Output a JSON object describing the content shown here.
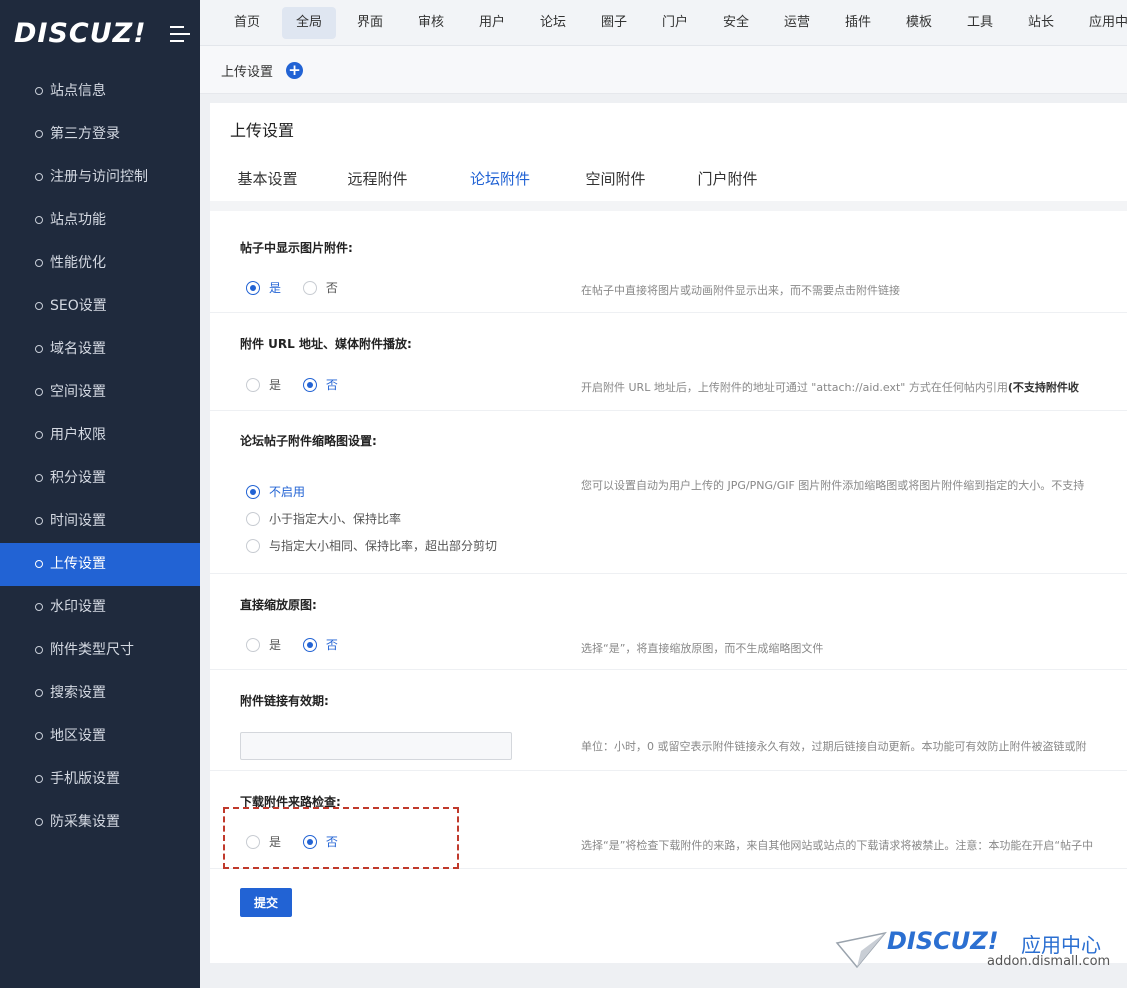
{
  "brand": {
    "logo": "DISCUZ!"
  },
  "sidebar": {
    "items": [
      {
        "label": "站点信息"
      },
      {
        "label": "第三方登录"
      },
      {
        "label": "注册与访问控制"
      },
      {
        "label": "站点功能"
      },
      {
        "label": "性能优化"
      },
      {
        "label": "SEO设置"
      },
      {
        "label": "域名设置"
      },
      {
        "label": "空间设置"
      },
      {
        "label": "用户权限"
      },
      {
        "label": "积分设置"
      },
      {
        "label": "时间设置"
      },
      {
        "label": "上传设置",
        "active": true
      },
      {
        "label": "水印设置"
      },
      {
        "label": "附件类型尺寸"
      },
      {
        "label": "搜索设置"
      },
      {
        "label": "地区设置"
      },
      {
        "label": "手机版设置"
      },
      {
        "label": "防采集设置"
      }
    ]
  },
  "topnav": {
    "tabs": [
      "首页",
      "全局",
      "界面",
      "审核",
      "用户",
      "论坛",
      "圈子",
      "门户",
      "安全",
      "运营",
      "插件",
      "模板",
      "工具",
      "站长",
      "应用中心"
    ],
    "active": "全局"
  },
  "breadcrumb": {
    "label": "上传设置",
    "plus": "+"
  },
  "panel": {
    "title": "上传设置",
    "tabs": [
      "基本设置",
      "远程附件",
      "论坛附件",
      "空间附件",
      "门户附件"
    ],
    "active_tab": "论坛附件"
  },
  "sections": {
    "s1": {
      "title": "帖子中显示图片附件:",
      "opt_yes": "是",
      "opt_no": "否",
      "value": "是",
      "hint": "在帖子中直接将图片或动画附件显示出来，而不需要点击附件链接"
    },
    "s2": {
      "title": "附件 URL 地址、媒体附件播放:",
      "opt_yes": "是",
      "opt_no": "否",
      "value": "否",
      "hint": "开启附件 URL 地址后，上传附件的地址可通过 \"attach://aid.ext\" 方式在任何帖内引用",
      "hint_bold": "(不支持附件收"
    },
    "s3": {
      "title": "论坛帖子附件缩略图设置:",
      "options": [
        "不启用",
        "小于指定大小、保持比率",
        "与指定大小相同、保持比率，超出部分剪切"
      ],
      "value": "不启用",
      "hint": "您可以设置自动为用户上传的 JPG/PNG/GIF 图片附件添加缩略图或将图片附件缩到指定的大小。不支持"
    },
    "s4": {
      "title": "直接缩放原图:",
      "opt_yes": "是",
      "opt_no": "否",
      "value": "否",
      "hint": "选择“是”，将直接缩放原图，而不生成缩略图文件"
    },
    "s5": {
      "title": "附件链接有效期:",
      "input_value": "",
      "hint": "单位：小时，0 或留空表示附件链接永久有效，过期后链接自动更新。本功能可有效防止附件被盗链或附"
    },
    "s6": {
      "title": "下载附件来路检查:",
      "opt_yes": "是",
      "opt_no": "否",
      "value": "否",
      "hint": "选择“是”将检查下载附件的来路，来自其他网站或站点的下载请求将被禁止。注意：本功能在开启“帖子中"
    }
  },
  "submit_label": "提交",
  "footer_logo": {
    "brand": "DISCUZ!",
    "center": "应用中心",
    "url": "addon.dismall.com"
  },
  "colors": {
    "accent": "#2263d4",
    "sidebar_bg": "#1f2a3d",
    "highlight": "#c0392b"
  }
}
